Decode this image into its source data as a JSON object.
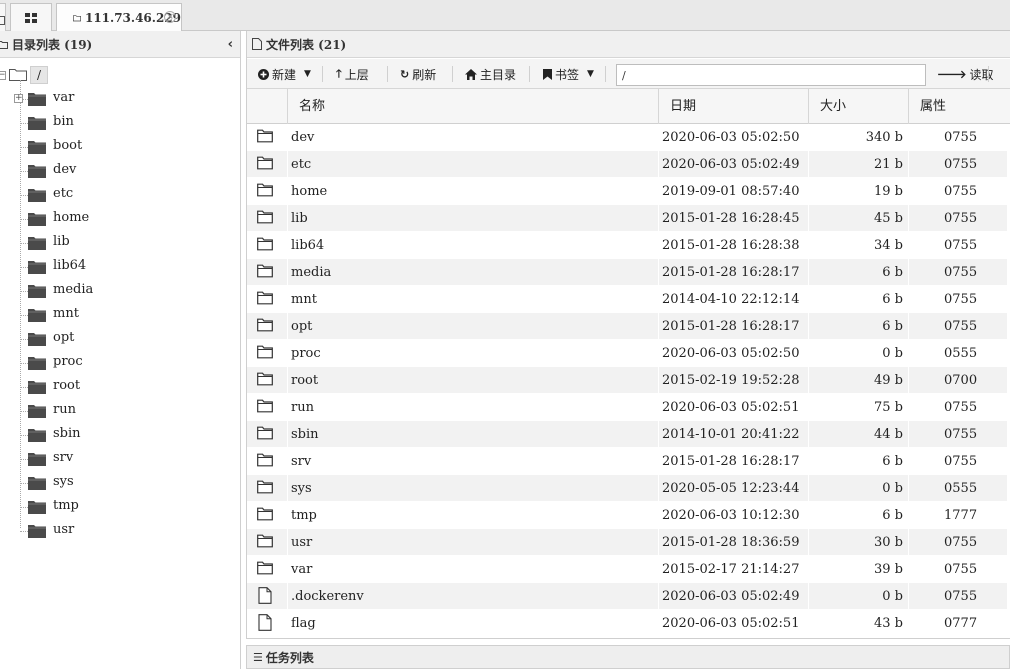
{
  "tabs": {
    "host_label": "111.73.46.229",
    "close_glyph": "×"
  },
  "left": {
    "title": "目录列表 (19)",
    "collapse_glyph": "‹",
    "root_label": "/",
    "items": [
      "var",
      "bin",
      "boot",
      "dev",
      "etc",
      "home",
      "lib",
      "lib64",
      "media",
      "mnt",
      "opt",
      "proc",
      "root",
      "run",
      "sbin",
      "srv",
      "sys",
      "tmp",
      "usr"
    ]
  },
  "right": {
    "title": "文件列表 (21)",
    "toolbar": {
      "new_label": "新建",
      "up_label": "上层",
      "refresh_label": "刷新",
      "home_label": "主目录",
      "bookmark_label": "书签",
      "path_value": "/",
      "read_label": "读取"
    },
    "columns": {
      "name": "名称",
      "date": "日期",
      "size": "大小",
      "attr": "属性"
    },
    "files": [
      {
        "type": "folder",
        "name": "dev",
        "date": "2020-06-03 05:02:50",
        "size": "340 b",
        "attr": "0755"
      },
      {
        "type": "folder",
        "name": "etc",
        "date": "2020-06-03 05:02:49",
        "size": "21 b",
        "attr": "0755"
      },
      {
        "type": "folder",
        "name": "home",
        "date": "2019-09-01 08:57:40",
        "size": "19 b",
        "attr": "0755"
      },
      {
        "type": "folder",
        "name": "lib",
        "date": "2015-01-28 16:28:45",
        "size": "45 b",
        "attr": "0755"
      },
      {
        "type": "folder",
        "name": "lib64",
        "date": "2015-01-28 16:28:38",
        "size": "34 b",
        "attr": "0755"
      },
      {
        "type": "folder",
        "name": "media",
        "date": "2015-01-28 16:28:17",
        "size": "6 b",
        "attr": "0755"
      },
      {
        "type": "folder",
        "name": "mnt",
        "date": "2014-04-10 22:12:14",
        "size": "6 b",
        "attr": "0755"
      },
      {
        "type": "folder",
        "name": "opt",
        "date": "2015-01-28 16:28:17",
        "size": "6 b",
        "attr": "0755"
      },
      {
        "type": "folder",
        "name": "proc",
        "date": "2020-06-03 05:02:50",
        "size": "0 b",
        "attr": "0555"
      },
      {
        "type": "folder",
        "name": "root",
        "date": "2015-02-19 19:52:28",
        "size": "49 b",
        "attr": "0700"
      },
      {
        "type": "folder",
        "name": "run",
        "date": "2020-06-03 05:02:51",
        "size": "75 b",
        "attr": "0755"
      },
      {
        "type": "folder",
        "name": "sbin",
        "date": "2014-10-01 20:41:22",
        "size": "44 b",
        "attr": "0755"
      },
      {
        "type": "folder",
        "name": "srv",
        "date": "2015-01-28 16:28:17",
        "size": "6 b",
        "attr": "0755"
      },
      {
        "type": "folder",
        "name": "sys",
        "date": "2020-05-05 12:23:44",
        "size": "0 b",
        "attr": "0555"
      },
      {
        "type": "folder",
        "name": "tmp",
        "date": "2020-06-03 10:12:30",
        "size": "6 b",
        "attr": "1777"
      },
      {
        "type": "folder",
        "name": "usr",
        "date": "2015-01-28 18:36:59",
        "size": "30 b",
        "attr": "0755"
      },
      {
        "type": "folder",
        "name": "var",
        "date": "2015-02-17 21:14:27",
        "size": "39 b",
        "attr": "0755"
      },
      {
        "type": "file",
        "name": ".dockerenv",
        "date": "2020-06-03 05:02:49",
        "size": "0 b",
        "attr": "0755"
      },
      {
        "type": "file",
        "name": "flag",
        "date": "2020-06-03 05:02:51",
        "size": "43 b",
        "attr": "0777"
      }
    ]
  },
  "tasks": {
    "title": "任务列表"
  }
}
